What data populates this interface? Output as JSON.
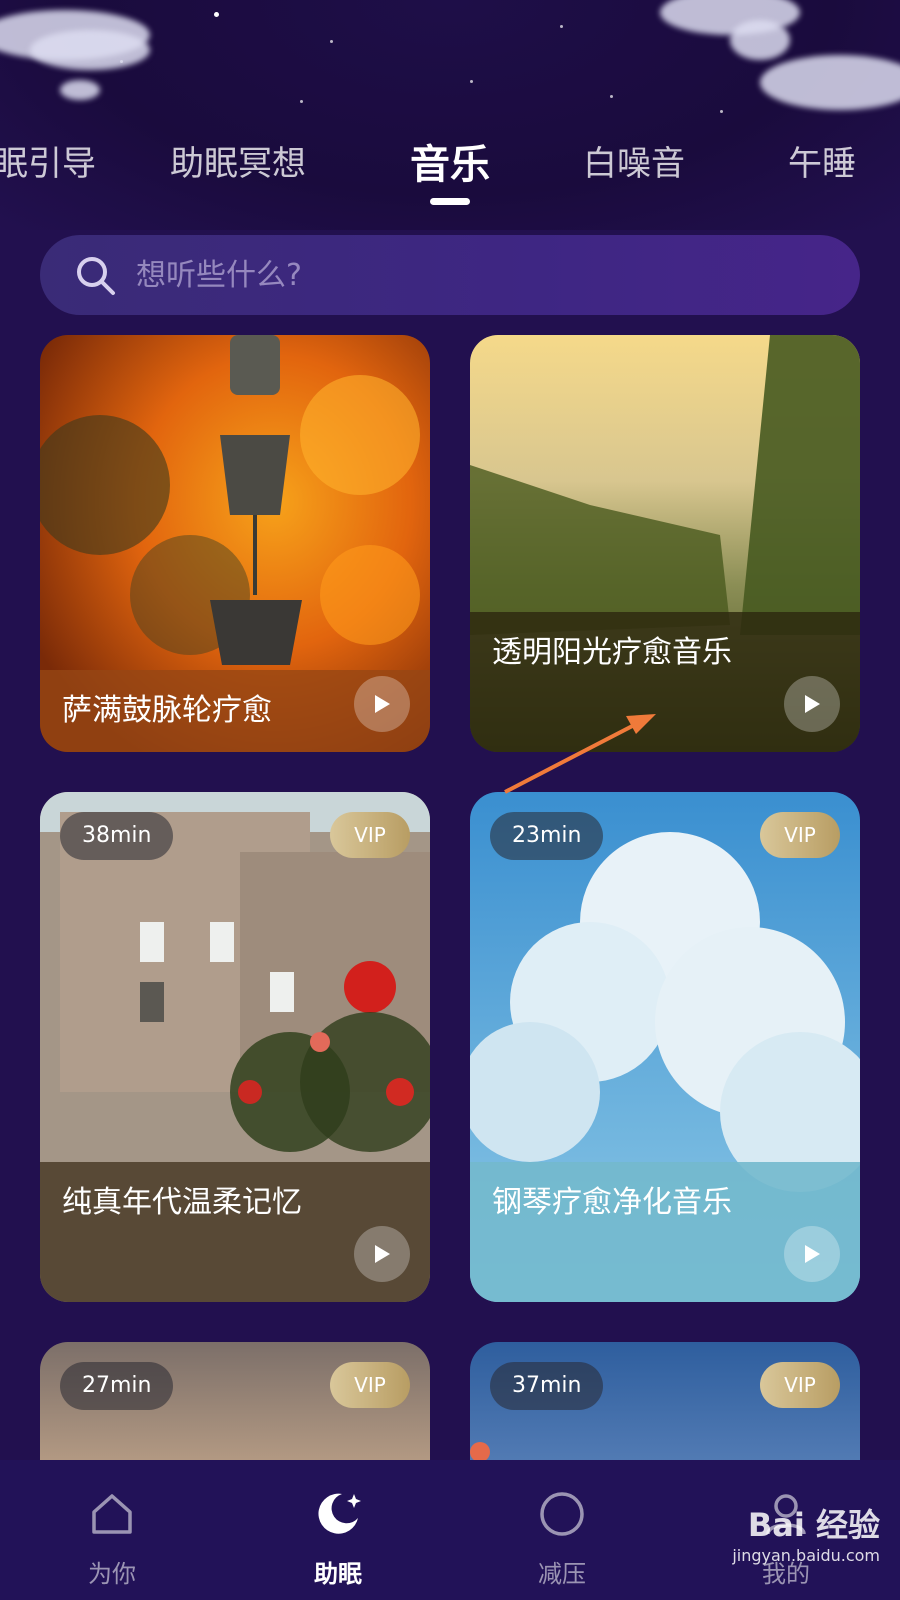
{
  "tabs": [
    {
      "label": "眠引导"
    },
    {
      "label": "助眠冥想"
    },
    {
      "label": "音乐"
    },
    {
      "label": "白噪音"
    },
    {
      "label": "午睡"
    }
  ],
  "active_tab": "音乐",
  "search": {
    "placeholder": "想听些什么?"
  },
  "cards": [
    {
      "title": "萨满鼓脉轮疗愈",
      "duration": "",
      "vip": ""
    },
    {
      "title": "透明阳光疗愈音乐",
      "duration": "",
      "vip": ""
    },
    {
      "title": "纯真年代温柔记忆",
      "duration": "38min",
      "vip": "VIP"
    },
    {
      "title": "钢琴疗愈净化音乐",
      "duration": "23min",
      "vip": "VIP"
    },
    {
      "title": "",
      "duration": "27min",
      "vip": "VIP"
    },
    {
      "title": "",
      "duration": "37min",
      "vip": "VIP"
    }
  ],
  "bottom_nav": [
    {
      "label": "为你",
      "icon": "home-icon"
    },
    {
      "label": "助眠",
      "icon": "moon-icon"
    },
    {
      "label": "减压",
      "icon": "circle-icon"
    },
    {
      "label": "我的",
      "icon": "profile-icon"
    }
  ],
  "watermark": {
    "logo": "Bai 经验",
    "url": "jingyan.baidu.com"
  },
  "colors": {
    "background": "#22104f",
    "nav_background": "#221258",
    "annotation_arrow": "#f07a3a",
    "vip_gold": "#c9b07a"
  }
}
